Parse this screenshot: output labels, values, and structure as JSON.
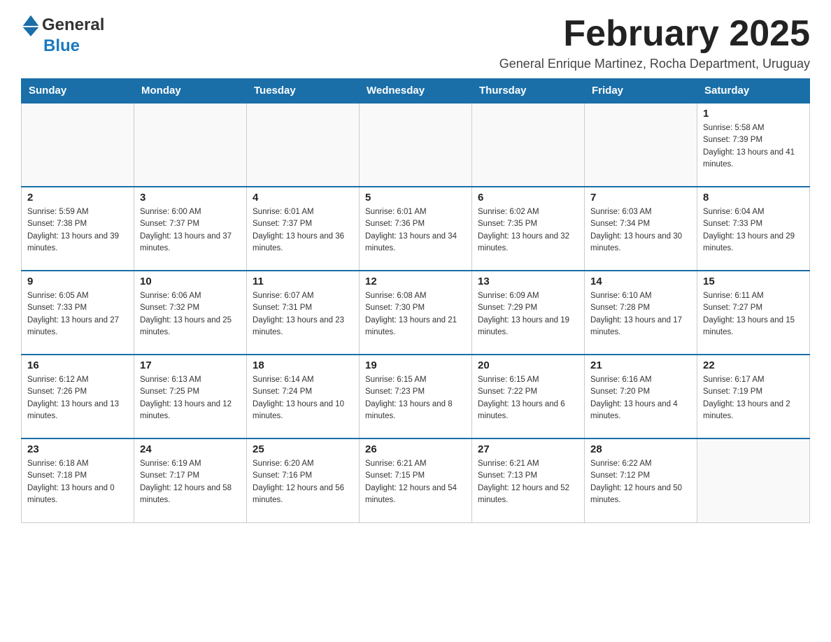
{
  "header": {
    "logo_general": "General",
    "logo_blue": "Blue",
    "month_title": "February 2025",
    "subtitle": "General Enrique Martinez, Rocha Department, Uruguay"
  },
  "days_of_week": [
    "Sunday",
    "Monday",
    "Tuesday",
    "Wednesday",
    "Thursday",
    "Friday",
    "Saturday"
  ],
  "weeks": [
    [
      {
        "day": "",
        "info": ""
      },
      {
        "day": "",
        "info": ""
      },
      {
        "day": "",
        "info": ""
      },
      {
        "day": "",
        "info": ""
      },
      {
        "day": "",
        "info": ""
      },
      {
        "day": "",
        "info": ""
      },
      {
        "day": "1",
        "info": "Sunrise: 5:58 AM\nSunset: 7:39 PM\nDaylight: 13 hours and 41 minutes."
      }
    ],
    [
      {
        "day": "2",
        "info": "Sunrise: 5:59 AM\nSunset: 7:38 PM\nDaylight: 13 hours and 39 minutes."
      },
      {
        "day": "3",
        "info": "Sunrise: 6:00 AM\nSunset: 7:37 PM\nDaylight: 13 hours and 37 minutes."
      },
      {
        "day": "4",
        "info": "Sunrise: 6:01 AM\nSunset: 7:37 PM\nDaylight: 13 hours and 36 minutes."
      },
      {
        "day": "5",
        "info": "Sunrise: 6:01 AM\nSunset: 7:36 PM\nDaylight: 13 hours and 34 minutes."
      },
      {
        "day": "6",
        "info": "Sunrise: 6:02 AM\nSunset: 7:35 PM\nDaylight: 13 hours and 32 minutes."
      },
      {
        "day": "7",
        "info": "Sunrise: 6:03 AM\nSunset: 7:34 PM\nDaylight: 13 hours and 30 minutes."
      },
      {
        "day": "8",
        "info": "Sunrise: 6:04 AM\nSunset: 7:33 PM\nDaylight: 13 hours and 29 minutes."
      }
    ],
    [
      {
        "day": "9",
        "info": "Sunrise: 6:05 AM\nSunset: 7:33 PM\nDaylight: 13 hours and 27 minutes."
      },
      {
        "day": "10",
        "info": "Sunrise: 6:06 AM\nSunset: 7:32 PM\nDaylight: 13 hours and 25 minutes."
      },
      {
        "day": "11",
        "info": "Sunrise: 6:07 AM\nSunset: 7:31 PM\nDaylight: 13 hours and 23 minutes."
      },
      {
        "day": "12",
        "info": "Sunrise: 6:08 AM\nSunset: 7:30 PM\nDaylight: 13 hours and 21 minutes."
      },
      {
        "day": "13",
        "info": "Sunrise: 6:09 AM\nSunset: 7:29 PM\nDaylight: 13 hours and 19 minutes."
      },
      {
        "day": "14",
        "info": "Sunrise: 6:10 AM\nSunset: 7:28 PM\nDaylight: 13 hours and 17 minutes."
      },
      {
        "day": "15",
        "info": "Sunrise: 6:11 AM\nSunset: 7:27 PM\nDaylight: 13 hours and 15 minutes."
      }
    ],
    [
      {
        "day": "16",
        "info": "Sunrise: 6:12 AM\nSunset: 7:26 PM\nDaylight: 13 hours and 13 minutes."
      },
      {
        "day": "17",
        "info": "Sunrise: 6:13 AM\nSunset: 7:25 PM\nDaylight: 13 hours and 12 minutes."
      },
      {
        "day": "18",
        "info": "Sunrise: 6:14 AM\nSunset: 7:24 PM\nDaylight: 13 hours and 10 minutes."
      },
      {
        "day": "19",
        "info": "Sunrise: 6:15 AM\nSunset: 7:23 PM\nDaylight: 13 hours and 8 minutes."
      },
      {
        "day": "20",
        "info": "Sunrise: 6:15 AM\nSunset: 7:22 PM\nDaylight: 13 hours and 6 minutes."
      },
      {
        "day": "21",
        "info": "Sunrise: 6:16 AM\nSunset: 7:20 PM\nDaylight: 13 hours and 4 minutes."
      },
      {
        "day": "22",
        "info": "Sunrise: 6:17 AM\nSunset: 7:19 PM\nDaylight: 13 hours and 2 minutes."
      }
    ],
    [
      {
        "day": "23",
        "info": "Sunrise: 6:18 AM\nSunset: 7:18 PM\nDaylight: 13 hours and 0 minutes."
      },
      {
        "day": "24",
        "info": "Sunrise: 6:19 AM\nSunset: 7:17 PM\nDaylight: 12 hours and 58 minutes."
      },
      {
        "day": "25",
        "info": "Sunrise: 6:20 AM\nSunset: 7:16 PM\nDaylight: 12 hours and 56 minutes."
      },
      {
        "day": "26",
        "info": "Sunrise: 6:21 AM\nSunset: 7:15 PM\nDaylight: 12 hours and 54 minutes."
      },
      {
        "day": "27",
        "info": "Sunrise: 6:21 AM\nSunset: 7:13 PM\nDaylight: 12 hours and 52 minutes."
      },
      {
        "day": "28",
        "info": "Sunrise: 6:22 AM\nSunset: 7:12 PM\nDaylight: 12 hours and 50 minutes."
      },
      {
        "day": "",
        "info": ""
      }
    ]
  ]
}
